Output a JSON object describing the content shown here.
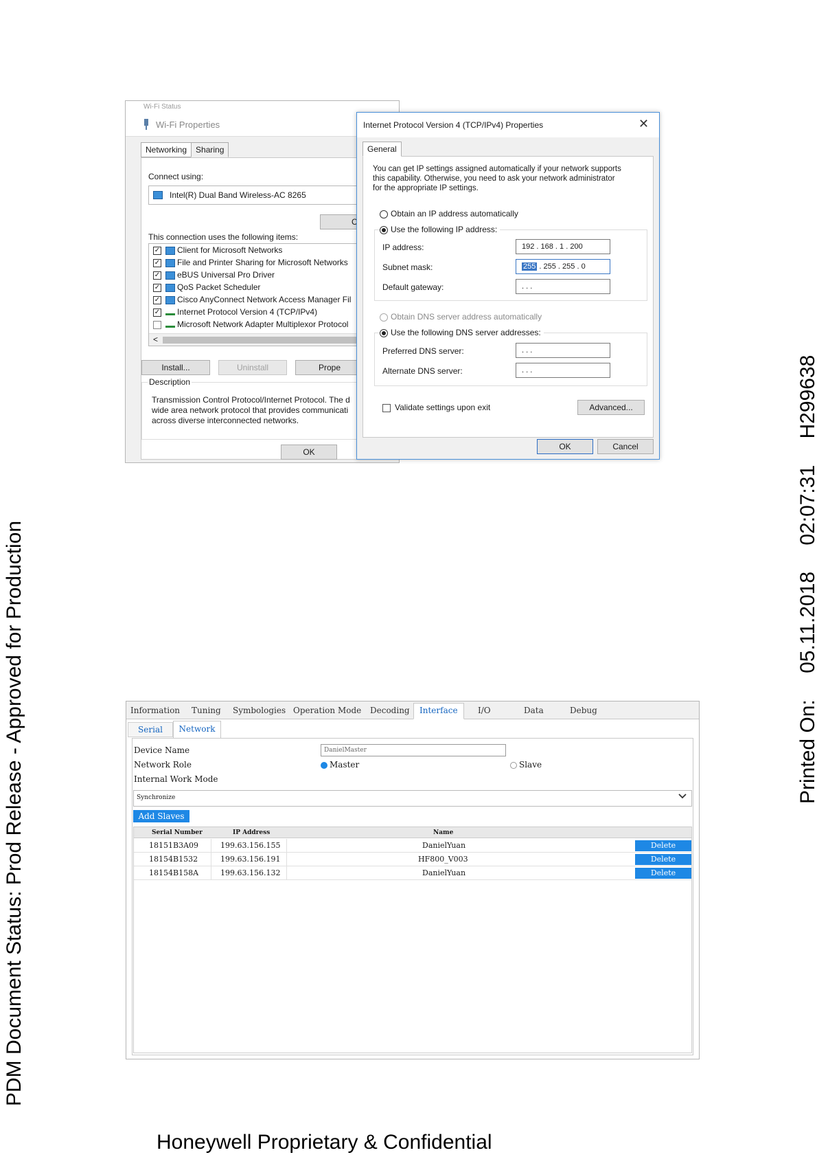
{
  "margin": {
    "pdm_status": "PDM Document Status: Prod Release - Approved for Production",
    "printed_on_label": "Printed On:",
    "printed_date": "05.11.2018",
    "printed_time": "02:07:31",
    "doc_number": "H299638"
  },
  "footer": {
    "confidential": "Honeywell Proprietary & Confidential"
  },
  "wifi_properties": {
    "status_caption": "Wi-Fi Status",
    "title": "Wi-Fi Properties",
    "tabs": [
      {
        "label": "Networking"
      },
      {
        "label": "Sharing"
      }
    ],
    "connect_using_label": "Connect using:",
    "adapter_name": "Intel(R) Dual Band Wireless-AC 8265",
    "configure_button": "Confi",
    "items_label": "This connection uses the following items:",
    "items": [
      {
        "label": "Client for Microsoft Networks",
        "checked": true,
        "icon": "network-client-icon"
      },
      {
        "label": "File and Printer Sharing for Microsoft Networks",
        "checked": true,
        "icon": "network-service-icon"
      },
      {
        "label": "eBUS Universal Pro Driver",
        "checked": true,
        "icon": "network-service-icon"
      },
      {
        "label": "QoS Packet Scheduler",
        "checked": true,
        "icon": "network-service-icon"
      },
      {
        "label": "Cisco AnyConnect Network Access Manager Fil",
        "checked": true,
        "icon": "network-service-icon"
      },
      {
        "label": "Internet Protocol Version 4 (TCP/IPv4)",
        "checked": true,
        "icon": "protocol-icon"
      },
      {
        "label": "Microsoft Network Adapter Multiplexor Protocol",
        "checked": false,
        "icon": "protocol-icon"
      }
    ],
    "scroll_left": "<",
    "install_button": "Install...",
    "uninstall_button": "Uninstall",
    "properties_button": "Prope",
    "description_title": "Description",
    "description_lines": [
      "Transmission Control Protocol/Internet Protocol. The d",
      "wide area network protocol that provides communicati",
      "across diverse interconnected networks."
    ],
    "ok_button": "OK"
  },
  "ipv4_dialog": {
    "title": "Internet Protocol Version 4 (TCP/IPv4) Properties",
    "close_glyph": "✕",
    "tab": "General",
    "intro_lines": [
      "You can get IP settings assigned automatically if your network supports",
      "this capability. Otherwise, you need to ask your network administrator",
      "for the appropriate IP settings."
    ],
    "obtain_ip_auto": "Obtain an IP address automatically",
    "use_following_ip": "Use the following IP address:",
    "ip_address_label": "IP address:",
    "ip_address_value": "192 . 168 .   1   . 200",
    "subnet_mask_label": "Subnet mask:",
    "subnet_mask_highlight": "255",
    "subnet_mask_rest": " . 255 . 255 .   0",
    "default_gateway_label": "Default gateway:",
    "default_gateway_value": "       .       .       .",
    "obtain_dns_auto": "Obtain DNS server address automatically",
    "use_following_dns": "Use the following DNS server addresses:",
    "preferred_dns_label": "Preferred DNS server:",
    "preferred_dns_value": "       .       .       .",
    "alternate_dns_label": "Alternate DNS server:",
    "alternate_dns_value": "       .       .       .",
    "validate_label": "Validate settings upon exit",
    "advanced_button": "Advanced...",
    "ok_button": "OK",
    "cancel_button": "Cancel"
  },
  "config_tool": {
    "tabs": [
      {
        "label": "Information"
      },
      {
        "label": "Tuning"
      },
      {
        "label": "Symbologies"
      },
      {
        "label": "Operation Mode"
      },
      {
        "label": "Decoding"
      },
      {
        "label": "Interface"
      },
      {
        "label": "I/O"
      },
      {
        "label": "Data"
      },
      {
        "label": "Debug"
      }
    ],
    "active_tab": "Interface",
    "subtabs": [
      {
        "label": "Serial"
      },
      {
        "label": "Network"
      }
    ],
    "device_name_label": "Device Name",
    "device_name_value": "DanielMaster",
    "network_role_label": "Network Role",
    "role_master": "Master",
    "role_slave": "Slave",
    "internal_work_mode_label": "Internal Work Mode",
    "work_mode_value": "Synchronize",
    "add_slaves_button": "Add Slaves",
    "table": {
      "headers": [
        "Serial Number",
        "IP Address",
        "Name"
      ],
      "rows": [
        {
          "serial": "18151B3A09",
          "ip": "199.63.156.155",
          "name": "DanielYuan",
          "action": "Delete"
        },
        {
          "serial": "18154B1532",
          "ip": "199.63.156.191",
          "name": "HF800_V003",
          "action": "Delete"
        },
        {
          "serial": "18154B158A",
          "ip": "199.63.156.132",
          "name": "DanielYuan",
          "action": "Delete"
        }
      ]
    }
  }
}
